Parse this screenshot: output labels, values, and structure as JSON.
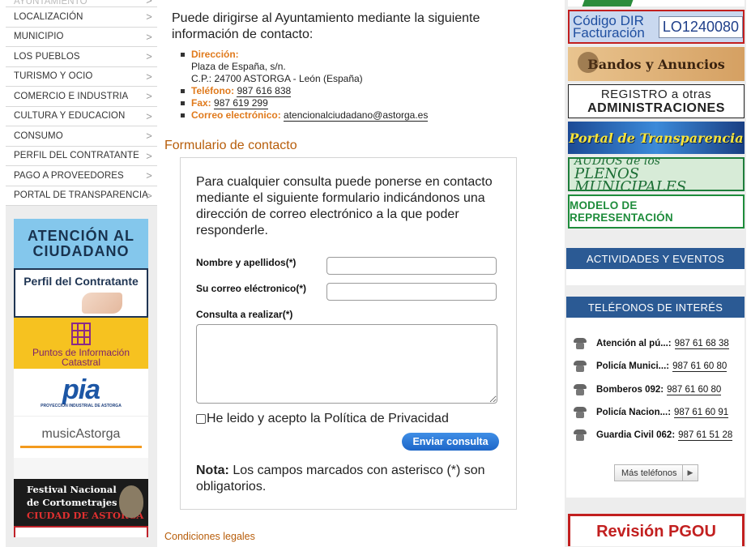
{
  "left_menu": {
    "items": [
      {
        "label": "AYUNTAMIENTO"
      },
      {
        "label": "LOCALIZACIÓN"
      },
      {
        "label": "MUNICIPIO"
      },
      {
        "label": "LOS PUEBLOS"
      },
      {
        "label": "TURISMO Y OCIO"
      },
      {
        "label": "COMERCIO E INDUSTRIA"
      },
      {
        "label": "CULTURA Y EDUCACION"
      },
      {
        "label": "CONSUMO"
      },
      {
        "label": "PERFIL DEL CONTRATANTE"
      },
      {
        "label": "PAGO A PROVEEDORES"
      },
      {
        "label": "PORTAL DE TRANSPARENCIA"
      }
    ],
    "chevron": ">"
  },
  "left_banners": {
    "atencion": "ATENCIÓN AL CIUDADANO",
    "perfil": "Perfil del Contratante",
    "catastro": "Puntos de Información Catastral",
    "pia": {
      "logo": "pia",
      "sub": "PROYECCIÓN INDUSTRIAL DE ASTORGA"
    },
    "music": "musicAstorga",
    "festival": {
      "line1": "Festival Nacional",
      "line2": "de Cortometrajes",
      "line3": "CIUDAD DE ASTORGA"
    }
  },
  "contact": {
    "intro": "Puede dirigirse al Ayuntamiento mediante la siguiente información de contacto:",
    "address_label": "Dirección:",
    "address_line1": "Plaza de España, s/n.",
    "address_line2": "C.P.: 24700 ASTORGA - León (España)",
    "phone_label": "Teléfono:",
    "phone": "987 616 838",
    "fax_label": "Fax:",
    "fax": "987 619 299",
    "email_label": "Correo electrónico:",
    "email": "atencionalciudadano@astorga.es"
  },
  "form": {
    "title": "Formulario de contacto",
    "intro": "Para cualquier consulta puede ponerse en contacto mediante el siguiente formulario indicándonos una dirección de correo electrónico a la que poder responderle.",
    "name_label": "Nombre y apellidos(*)",
    "name_value": "",
    "email_label": "Su correo eléctronico(*)",
    "email_value": "",
    "query_label": "Consulta a realizar(*)",
    "query_value": "",
    "privacy_label": "He leido y acepto la Política de Privacidad",
    "privacy_checked": false,
    "submit_label": "Enviar consulta",
    "note_bold": "Nota:",
    "note_text": " Los campos marcados con asterisco (*) son obligatorios."
  },
  "legal_link": "Condiciones legales",
  "right_banners": {
    "dir_title": "Código DIR Facturación",
    "dir_code": "LO1240080",
    "bandos": "Bandos y Anuncios",
    "registro_line1": "REGISTRO a otras",
    "registro_line2": "ADMINISTRACIONES",
    "portal": "Portal de Transparencia",
    "audios_line1": "AUDIOS de los",
    "audios_line2": "PLENOS MUNICIPALES",
    "modelo": "MODELO DE REPRESENTACIÓN",
    "pgou": "Revisión PGOU"
  },
  "right_sections": {
    "actividades": "ACTIVIDADES Y EVENTOS",
    "telefonos": "TELÉFONOS DE INTERÉS",
    "phones": [
      {
        "name": "Atención al pú...:",
        "number": "987 61 68 38"
      },
      {
        "name": "Policía Munici...:",
        "number": "987 61 60 80"
      },
      {
        "name": "Bomberos 092:",
        "number": "987 61 60 80"
      },
      {
        "name": "Policía Nacion...:",
        "number": "987 61 60 91"
      },
      {
        "name": "Guardia Civil 062:",
        "number": "987 61 51 28"
      }
    ],
    "mas_telefonos": "Más teléfonos",
    "mas_arrow": "▶"
  },
  "colors": {
    "accent_orange": "#e07a1c",
    "section_blue": "#2b5a94",
    "button_blue": "#1d66c8",
    "alert_red": "#c21f1f"
  }
}
